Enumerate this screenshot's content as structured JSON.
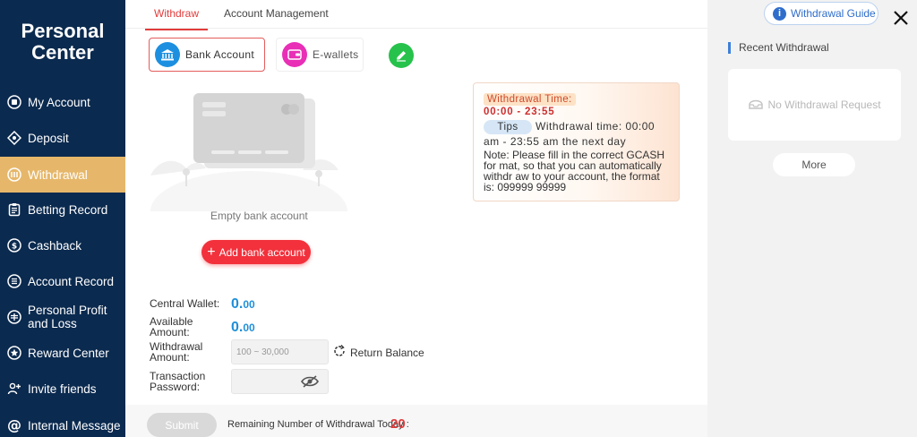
{
  "sidebar": {
    "title_line1": "Personal",
    "title_line2": "Center",
    "items": [
      {
        "label": "My Account",
        "icon": "account-circle-icon"
      },
      {
        "label": "Deposit",
        "icon": "diamond-icon"
      },
      {
        "label": "Withdrawal",
        "icon": "withdrawal-icon",
        "active": true
      },
      {
        "label": "Betting Record",
        "icon": "clipboard-icon"
      },
      {
        "label": "Cashback",
        "icon": "cashback-icon"
      },
      {
        "label": "Account Record",
        "icon": "record-icon"
      },
      {
        "label": "Personal Profit and Loss",
        "icon": "profit-loss-icon"
      },
      {
        "label": "Reward Center",
        "icon": "reward-icon"
      },
      {
        "label": "Invite friends",
        "icon": "invite-friends-icon"
      },
      {
        "label": "Internal Message",
        "icon": "at-sign-icon"
      }
    ]
  },
  "tabs": {
    "withdraw": "Withdraw",
    "account_management": "Account Management"
  },
  "methods": {
    "bank": "Bank Account",
    "ewallet": "E-wallets"
  },
  "empty": {
    "text": "Empty bank account",
    "add_button": "Add bank account"
  },
  "info": {
    "time_label": "Withdrawal Time:",
    "time_value": "00:00 - 23:55",
    "tips_badge": "Tips",
    "tips_text_1": "Withdrawal time: 00:00",
    "tips_text_2": "am - 23:55 am the next day",
    "note": "Note: Please fill in the correct GCASH for mat, so that you can automatically withdr aw to your account, the format is: 099999 99999"
  },
  "form": {
    "central_wallet_label": "Central Wallet:",
    "central_wallet_int": "0.",
    "central_wallet_dec": "00",
    "available_label_1": "Available",
    "available_label_2": "Amount:",
    "available_int": "0.",
    "available_dec": "00",
    "withdrawal_label_1": "Withdrawal",
    "withdrawal_label_2": "Amount:",
    "withdrawal_placeholder": "100 ~ 30,000",
    "return_balance": "Return Balance",
    "password_label_1": "Transaction",
    "password_label_2": "Password:"
  },
  "bottom": {
    "submit": "Submit",
    "remaining_label": "Remaining Number of Withdrawal Today :",
    "remaining_count": "20"
  },
  "right": {
    "guide_button": "Withdrawal Guide",
    "recent_title": "Recent Withdrawal",
    "no_request": "No Withdrawal Request",
    "more": "More"
  },
  "colors": {
    "sidebar_bg": "#0b2a4f",
    "active_item": "#e6b76a",
    "accent_red": "#e23b3b",
    "amount_blue": "#1f8fd8"
  }
}
